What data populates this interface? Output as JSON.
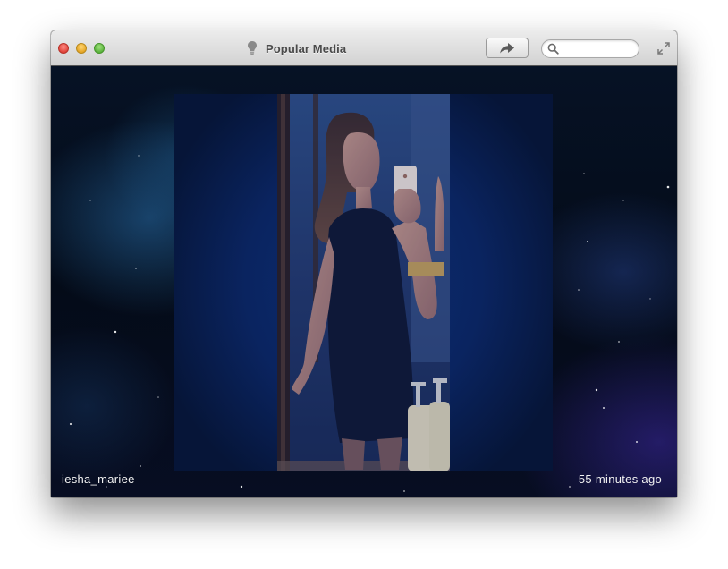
{
  "window": {
    "title": "Popular Media",
    "title_icon": "lightbulb-icon"
  },
  "toolbar": {
    "share_icon": "share-arrow-icon",
    "search_icon": "magnifier-icon",
    "search_value": "",
    "fullscreen_icon": "expand-arrows-icon"
  },
  "media": {
    "username": "iesha_mariee",
    "timestamp": "55 minutes ago"
  },
  "colors": {
    "background": "#061225",
    "panel": "#0a2460",
    "text": "#f2f2f2"
  }
}
